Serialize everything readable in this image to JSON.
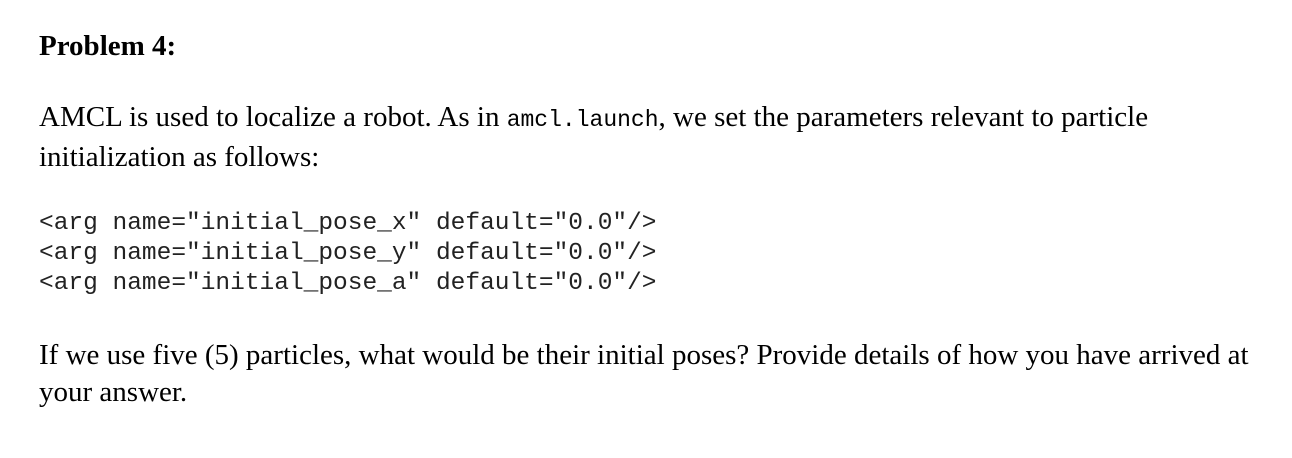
{
  "problem": {
    "title": "Problem 4:",
    "intro_part1": "AMCL is used to localize a robot.   As in ",
    "intro_code": "amcl.launch",
    "intro_part2": ", we set the parameters relevant to particle initialization as follows:",
    "code_lines": [
      "<arg name=\"initial_pose_x\" default=\"0.0\"/>",
      "<arg name=\"initial_pose_y\" default=\"0.0\"/>",
      "<arg name=\"initial_pose_a\" default=\"0.0\"/>"
    ],
    "question": "If we use five (5) particles, what would be their initial poses?   Provide details of how you have arrived at your answer."
  }
}
